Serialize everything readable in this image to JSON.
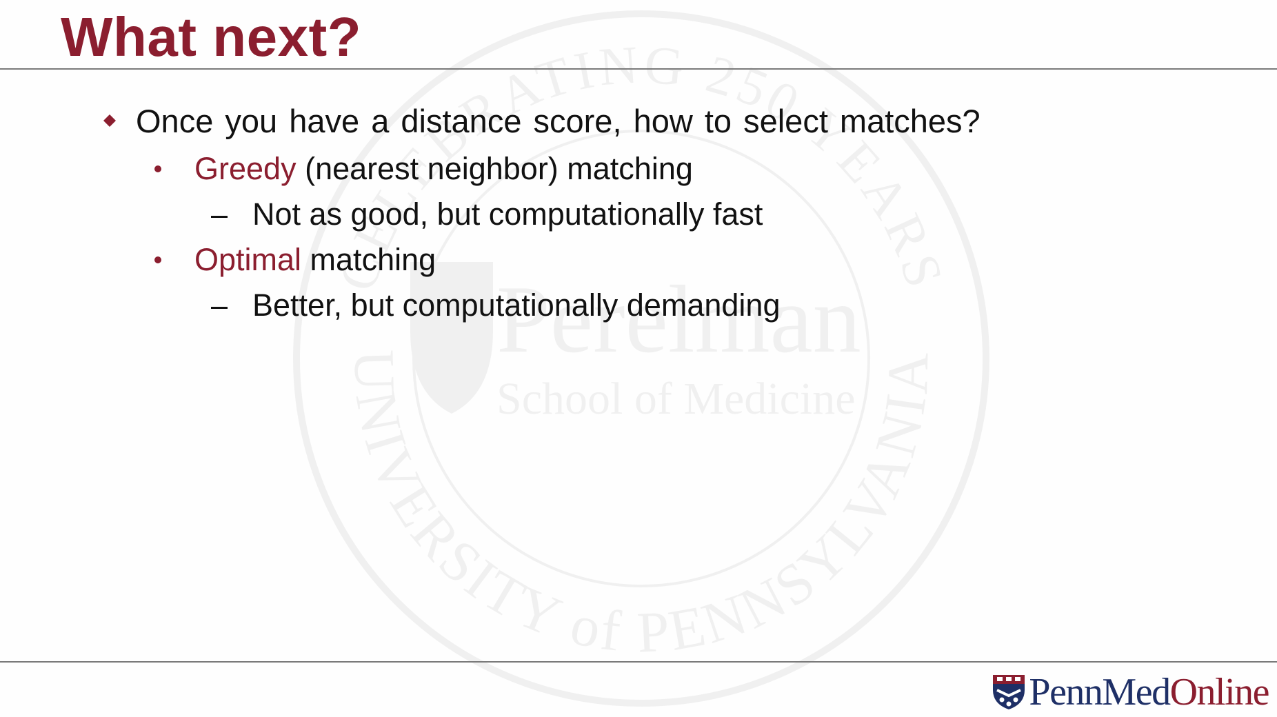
{
  "slide": {
    "title": "What next?",
    "bullets": [
      {
        "text": "Once you have a distance score, how to select matches?",
        "level": 1,
        "marker": "diamond-icon"
      },
      {
        "highlight": "Greedy",
        "text": " (nearest neighbor) matching",
        "level": 2,
        "marker": "dot-icon"
      },
      {
        "text": "Not as good, but computationally fast",
        "level": 3,
        "marker": "dash-icon"
      },
      {
        "highlight": "Optimal",
        "text": " matching",
        "level": 2,
        "marker": "dot-icon"
      },
      {
        "text": "Better, but computationally demanding",
        "level": 3,
        "marker": "dash-icon"
      }
    ]
  },
  "footer": {
    "logo": {
      "penn": "PennMed",
      "online": "Online",
      "icon": "penn-shield-icon"
    }
  },
  "watermark": {
    "ring_top": "CELEBRATING 250 YEARS",
    "ring_bottom": "UNIVERSITY of PENNSYLVANIA",
    "name": "Perelman",
    "subtitle": "School of Medicine"
  },
  "colors": {
    "accent": "#8b1e2f",
    "text": "#111111",
    "rule": "#7a7a7a",
    "logo_blue": "#1e2f66"
  }
}
